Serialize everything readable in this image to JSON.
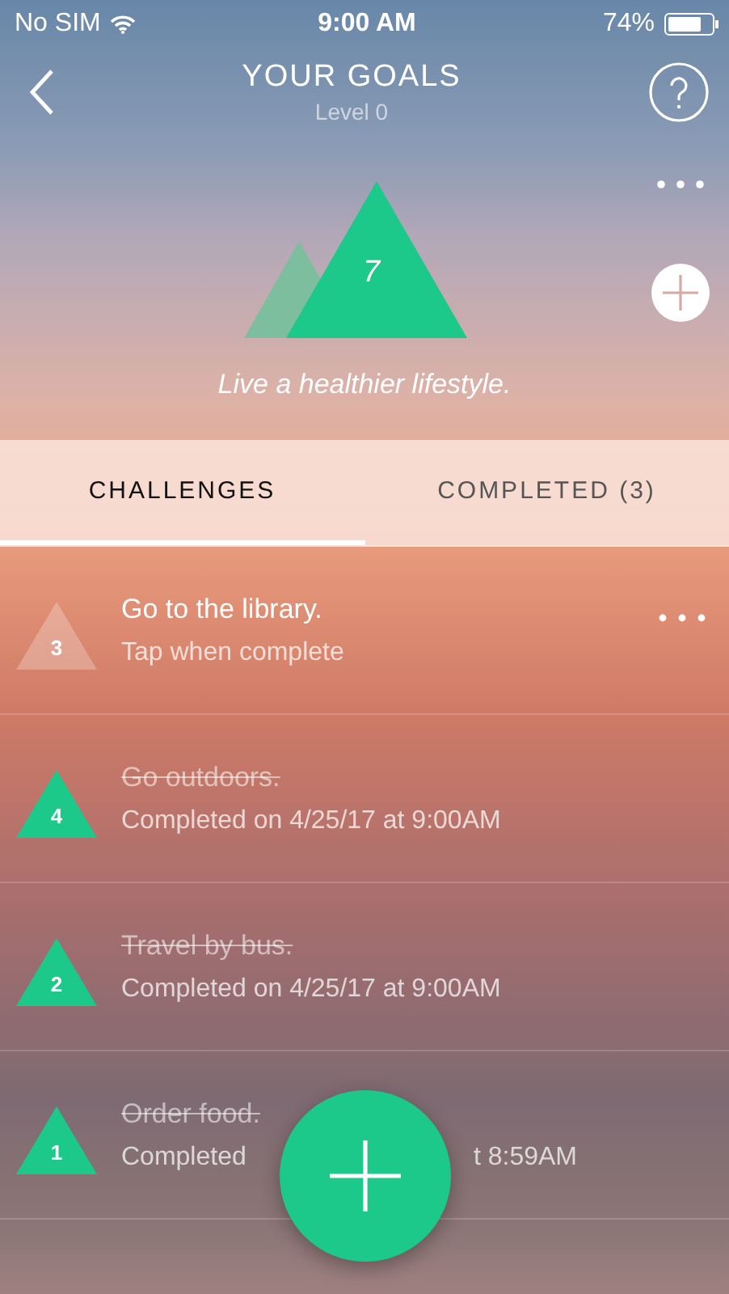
{
  "status_bar": {
    "carrier": "No SIM",
    "time": "9:00 AM",
    "battery": "74%"
  },
  "nav": {
    "title": "YOUR GOALS",
    "subtitle": "Level 0"
  },
  "goal": {
    "count": "7",
    "tagline": "Live a healthier lifestyle."
  },
  "tabs": [
    {
      "label": "CHALLENGES",
      "selected": true
    },
    {
      "label": "COMPLETED (3)",
      "selected": false
    }
  ],
  "challenges": [
    {
      "number": "3",
      "title": "Go to the library.",
      "detail": "Tap when complete",
      "completed": false
    },
    {
      "number": "4",
      "title": "Go outdoors.",
      "detail": "Completed on 4/25/17 at 9:00AM",
      "completed": true
    },
    {
      "number": "2",
      "title": "Travel by bus.",
      "detail": "Completed on 4/25/17 at 9:00AM",
      "completed": true
    },
    {
      "number": "1",
      "title": "Order food.",
      "detail": "Completed",
      "detail_tail": "t 8:59AM",
      "completed": true
    }
  ]
}
